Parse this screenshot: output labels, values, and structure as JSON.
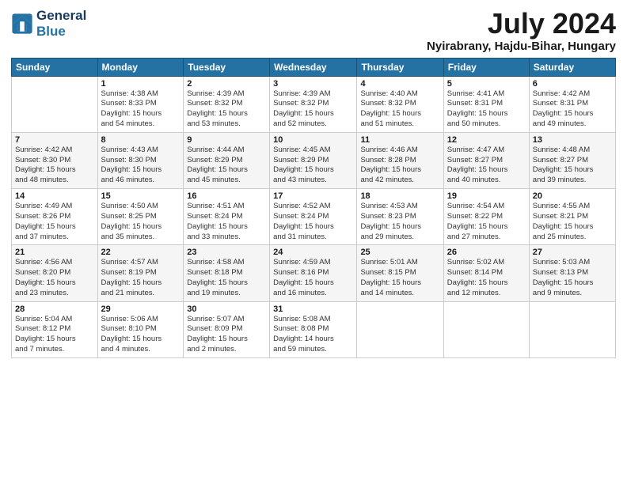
{
  "logo": {
    "line1": "General",
    "line2": "Blue"
  },
  "title": "July 2024",
  "location": "Nyirabrany, Hajdu-Bihar, Hungary",
  "headers": [
    "Sunday",
    "Monday",
    "Tuesday",
    "Wednesday",
    "Thursday",
    "Friday",
    "Saturday"
  ],
  "weeks": [
    [
      {
        "day": "",
        "info": ""
      },
      {
        "day": "1",
        "info": "Sunrise: 4:38 AM\nSunset: 8:33 PM\nDaylight: 15 hours\nand 54 minutes."
      },
      {
        "day": "2",
        "info": "Sunrise: 4:39 AM\nSunset: 8:32 PM\nDaylight: 15 hours\nand 53 minutes."
      },
      {
        "day": "3",
        "info": "Sunrise: 4:39 AM\nSunset: 8:32 PM\nDaylight: 15 hours\nand 52 minutes."
      },
      {
        "day": "4",
        "info": "Sunrise: 4:40 AM\nSunset: 8:32 PM\nDaylight: 15 hours\nand 51 minutes."
      },
      {
        "day": "5",
        "info": "Sunrise: 4:41 AM\nSunset: 8:31 PM\nDaylight: 15 hours\nand 50 minutes."
      },
      {
        "day": "6",
        "info": "Sunrise: 4:42 AM\nSunset: 8:31 PM\nDaylight: 15 hours\nand 49 minutes."
      }
    ],
    [
      {
        "day": "7",
        "info": "Sunrise: 4:42 AM\nSunset: 8:30 PM\nDaylight: 15 hours\nand 48 minutes."
      },
      {
        "day": "8",
        "info": "Sunrise: 4:43 AM\nSunset: 8:30 PM\nDaylight: 15 hours\nand 46 minutes."
      },
      {
        "day": "9",
        "info": "Sunrise: 4:44 AM\nSunset: 8:29 PM\nDaylight: 15 hours\nand 45 minutes."
      },
      {
        "day": "10",
        "info": "Sunrise: 4:45 AM\nSunset: 8:29 PM\nDaylight: 15 hours\nand 43 minutes."
      },
      {
        "day": "11",
        "info": "Sunrise: 4:46 AM\nSunset: 8:28 PM\nDaylight: 15 hours\nand 42 minutes."
      },
      {
        "day": "12",
        "info": "Sunrise: 4:47 AM\nSunset: 8:27 PM\nDaylight: 15 hours\nand 40 minutes."
      },
      {
        "day": "13",
        "info": "Sunrise: 4:48 AM\nSunset: 8:27 PM\nDaylight: 15 hours\nand 39 minutes."
      }
    ],
    [
      {
        "day": "14",
        "info": "Sunrise: 4:49 AM\nSunset: 8:26 PM\nDaylight: 15 hours\nand 37 minutes."
      },
      {
        "day": "15",
        "info": "Sunrise: 4:50 AM\nSunset: 8:25 PM\nDaylight: 15 hours\nand 35 minutes."
      },
      {
        "day": "16",
        "info": "Sunrise: 4:51 AM\nSunset: 8:24 PM\nDaylight: 15 hours\nand 33 minutes."
      },
      {
        "day": "17",
        "info": "Sunrise: 4:52 AM\nSunset: 8:24 PM\nDaylight: 15 hours\nand 31 minutes."
      },
      {
        "day": "18",
        "info": "Sunrise: 4:53 AM\nSunset: 8:23 PM\nDaylight: 15 hours\nand 29 minutes."
      },
      {
        "day": "19",
        "info": "Sunrise: 4:54 AM\nSunset: 8:22 PM\nDaylight: 15 hours\nand 27 minutes."
      },
      {
        "day": "20",
        "info": "Sunrise: 4:55 AM\nSunset: 8:21 PM\nDaylight: 15 hours\nand 25 minutes."
      }
    ],
    [
      {
        "day": "21",
        "info": "Sunrise: 4:56 AM\nSunset: 8:20 PM\nDaylight: 15 hours\nand 23 minutes."
      },
      {
        "day": "22",
        "info": "Sunrise: 4:57 AM\nSunset: 8:19 PM\nDaylight: 15 hours\nand 21 minutes."
      },
      {
        "day": "23",
        "info": "Sunrise: 4:58 AM\nSunset: 8:18 PM\nDaylight: 15 hours\nand 19 minutes."
      },
      {
        "day": "24",
        "info": "Sunrise: 4:59 AM\nSunset: 8:16 PM\nDaylight: 15 hours\nand 16 minutes."
      },
      {
        "day": "25",
        "info": "Sunrise: 5:01 AM\nSunset: 8:15 PM\nDaylight: 15 hours\nand 14 minutes."
      },
      {
        "day": "26",
        "info": "Sunrise: 5:02 AM\nSunset: 8:14 PM\nDaylight: 15 hours\nand 12 minutes."
      },
      {
        "day": "27",
        "info": "Sunrise: 5:03 AM\nSunset: 8:13 PM\nDaylight: 15 hours\nand 9 minutes."
      }
    ],
    [
      {
        "day": "28",
        "info": "Sunrise: 5:04 AM\nSunset: 8:12 PM\nDaylight: 15 hours\nand 7 minutes."
      },
      {
        "day": "29",
        "info": "Sunrise: 5:06 AM\nSunset: 8:10 PM\nDaylight: 15 hours\nand 4 minutes."
      },
      {
        "day": "30",
        "info": "Sunrise: 5:07 AM\nSunset: 8:09 PM\nDaylight: 15 hours\nand 2 minutes."
      },
      {
        "day": "31",
        "info": "Sunrise: 5:08 AM\nSunset: 8:08 PM\nDaylight: 14 hours\nand 59 minutes."
      },
      {
        "day": "",
        "info": ""
      },
      {
        "day": "",
        "info": ""
      },
      {
        "day": "",
        "info": ""
      }
    ]
  ]
}
